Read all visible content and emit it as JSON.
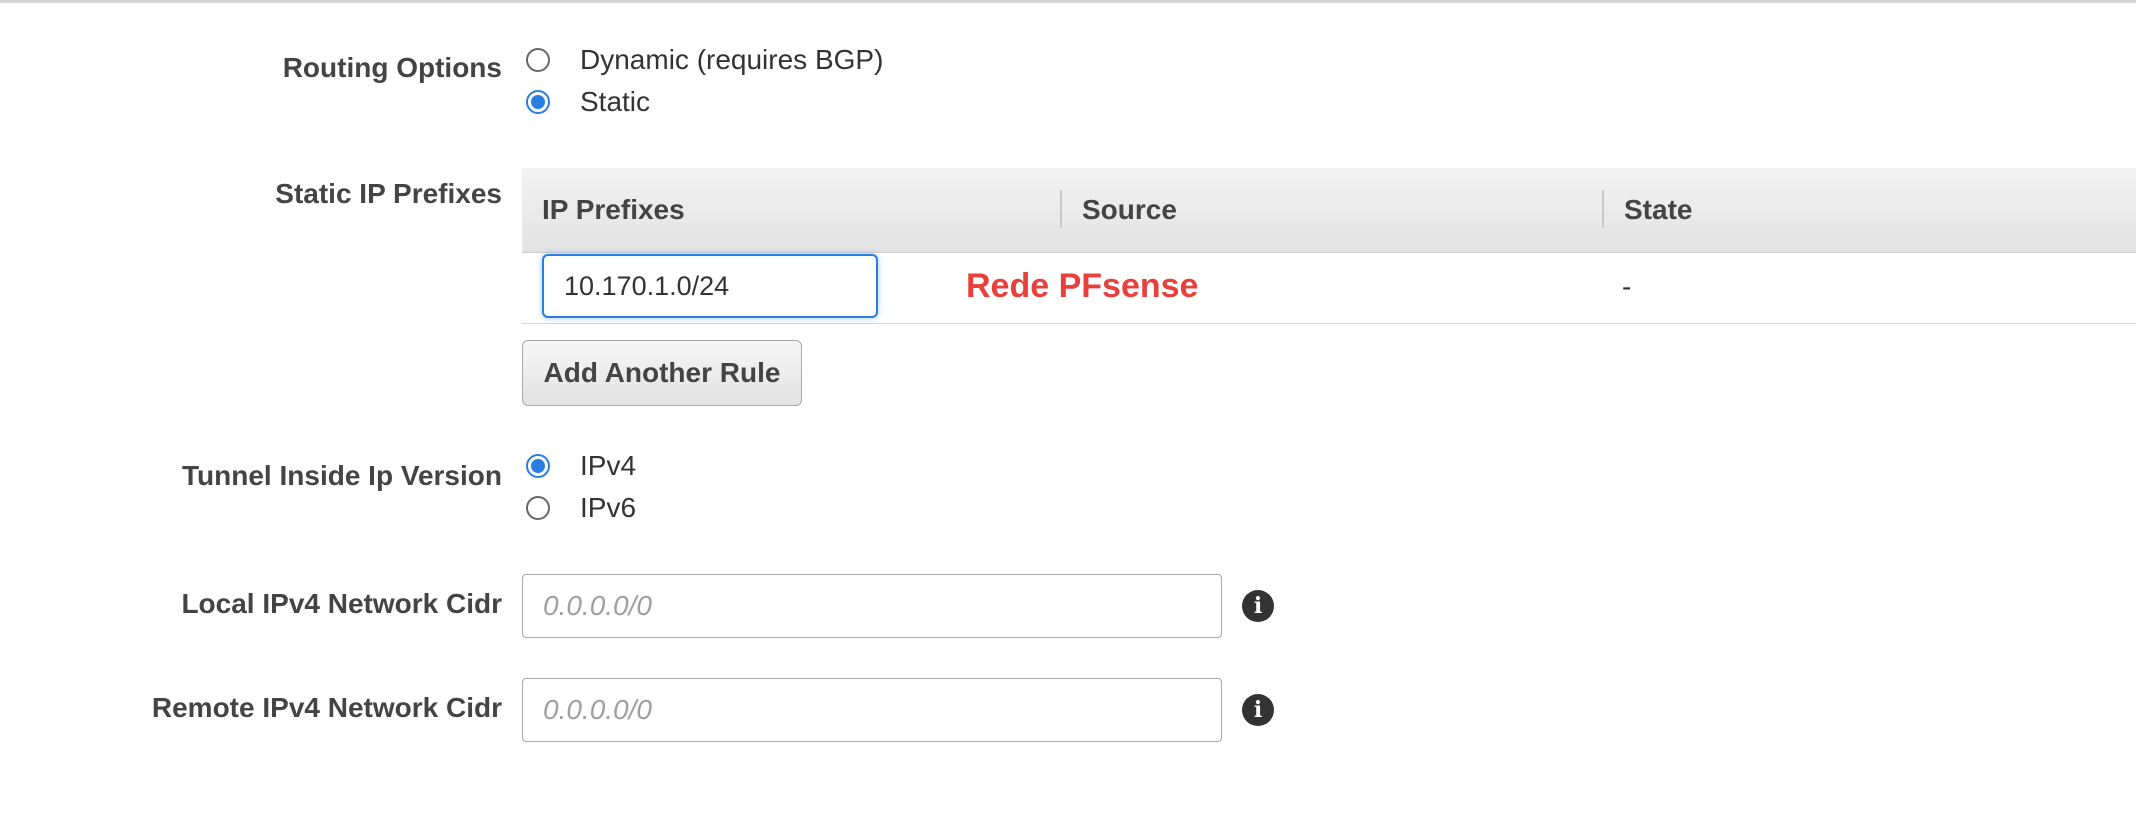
{
  "routing": {
    "label": "Routing Options",
    "options": [
      {
        "label": "Dynamic (requires BGP)",
        "checked": false
      },
      {
        "label": "Static",
        "checked": true
      }
    ]
  },
  "static_prefixes": {
    "label": "Static IP Prefixes",
    "columns": [
      "IP Prefixes",
      "Source",
      "State"
    ],
    "rows": [
      {
        "prefix": "10.170.1.0/24",
        "source_note": "Rede PFsense",
        "state": "-"
      }
    ],
    "add_button": "Add Another Rule"
  },
  "tunnel_version": {
    "label": "Tunnel Inside Ip Version",
    "options": [
      {
        "label": "IPv4",
        "checked": true
      },
      {
        "label": "IPv6",
        "checked": false
      }
    ]
  },
  "local_cidr": {
    "label": "Local IPv4 Network Cidr",
    "value": "",
    "placeholder": "0.0.0.0/0"
  },
  "remote_cidr": {
    "label": "Remote IPv4 Network Cidr",
    "value": "",
    "placeholder": "0.0.0.0/0"
  },
  "icons": {
    "info": "info-icon"
  },
  "colors": {
    "accent": "#2a7de1",
    "annotation": "#e8413c"
  }
}
